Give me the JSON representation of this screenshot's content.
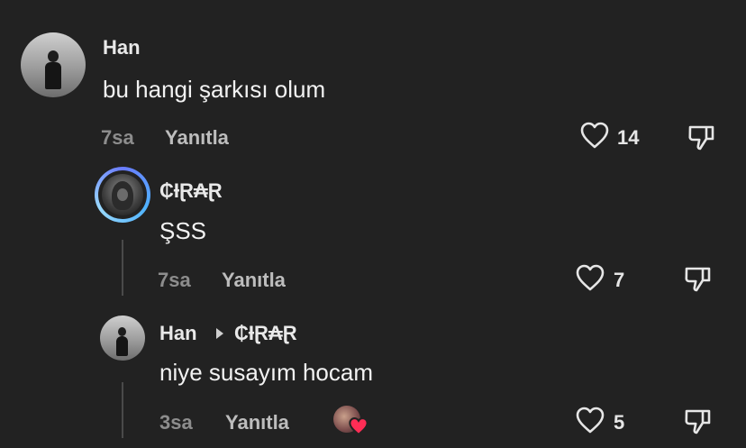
{
  "comments": [
    {
      "author": "Han",
      "text": "bu hangi şarkısı olum",
      "time": "7sa",
      "reply_label": "Yanıtla",
      "likes": "14",
      "avatar_icon": "person-photo-avatar"
    },
    {
      "author": "₵ƗⱤ₳Ɽ",
      "text": "ŞSS",
      "time": "7sa",
      "reply_label": "Yanıtla",
      "likes": "7",
      "avatar_icon": "hooded-figure-avatar",
      "avatar_ring_color": "#4fb3ff"
    },
    {
      "author": "Han",
      "reply_to": "₵ƗⱤ₳Ɽ",
      "text": "niye susayım hocam",
      "time": "3sa",
      "reply_label": "Yanıtla",
      "likes": "5",
      "avatar_icon": "person-photo-avatar",
      "creator_liked_icon": "creator-liked-heart-icon"
    }
  ],
  "colors": {
    "background": "#222222",
    "muted": "#8d8d8d",
    "heart_badge": "#ff2d55"
  }
}
